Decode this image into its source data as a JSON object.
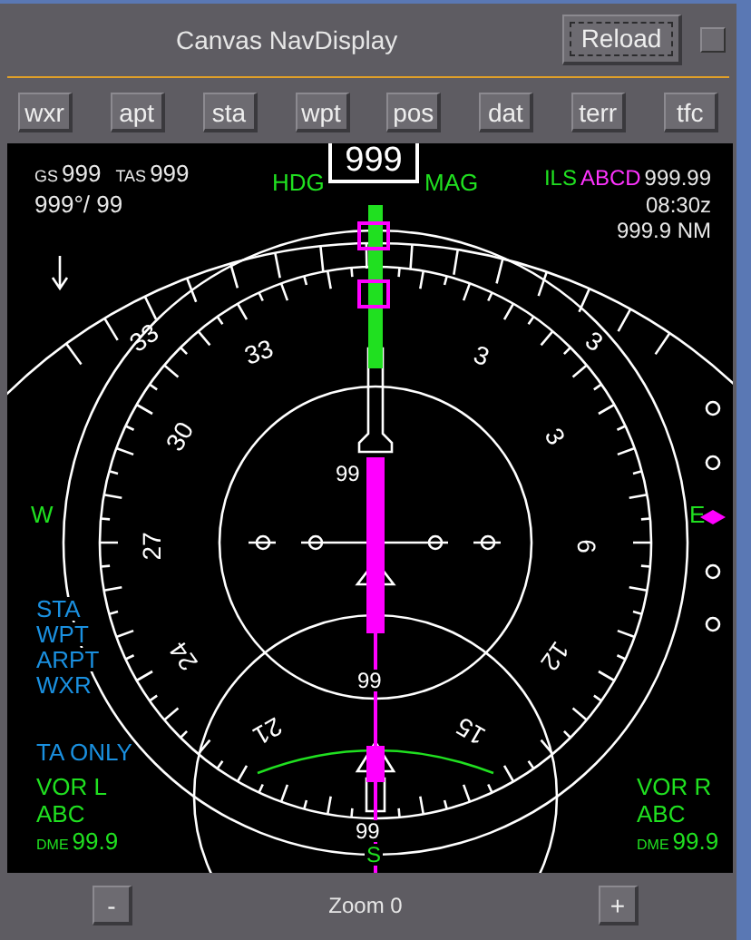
{
  "window": {
    "title": "Canvas NavDisplay",
    "reload": "Reload"
  },
  "toolbar": [
    {
      "label": "wxr"
    },
    {
      "label": "apt"
    },
    {
      "label": "sta"
    },
    {
      "label": "wpt"
    },
    {
      "label": "pos"
    },
    {
      "label": "dat"
    },
    {
      "label": "terr"
    },
    {
      "label": "tfc"
    }
  ],
  "display": {
    "gs_label": "GS",
    "gs": "999",
    "tas_label": "TAS",
    "tas": "999",
    "wind": "999°/ 99",
    "heading_label": "HDG",
    "heading": "999",
    "heading_ref": "MAG",
    "nav_mode": "ILS",
    "nav_id": "ABCD",
    "frequency": "999.99",
    "eta": "08:30z",
    "distance": "999.9 NM",
    "compass_labels": [
      "33",
      "33",
      "3",
      "3",
      "30",
      "27",
      "24",
      "3",
      "6",
      "12",
      "21",
      "15"
    ],
    "range_labels": [
      "99",
      "99",
      "99"
    ],
    "west": "W",
    "east": "E",
    "south": "S",
    "map_options": [
      "STA",
      "WPT",
      "ARPT",
      "WXR"
    ],
    "tcas": "TA ONLY",
    "vor_left": {
      "label": "VOR L",
      "id": "ABC",
      "dme_label": "DME",
      "dme": "99.9"
    },
    "vor_right": {
      "label": "VOR R",
      "id": "ABC",
      "dme_label": "DME",
      "dme": "99.9"
    }
  },
  "zoom": {
    "minus": "-",
    "label": "Zoom 0",
    "plus": "+"
  }
}
